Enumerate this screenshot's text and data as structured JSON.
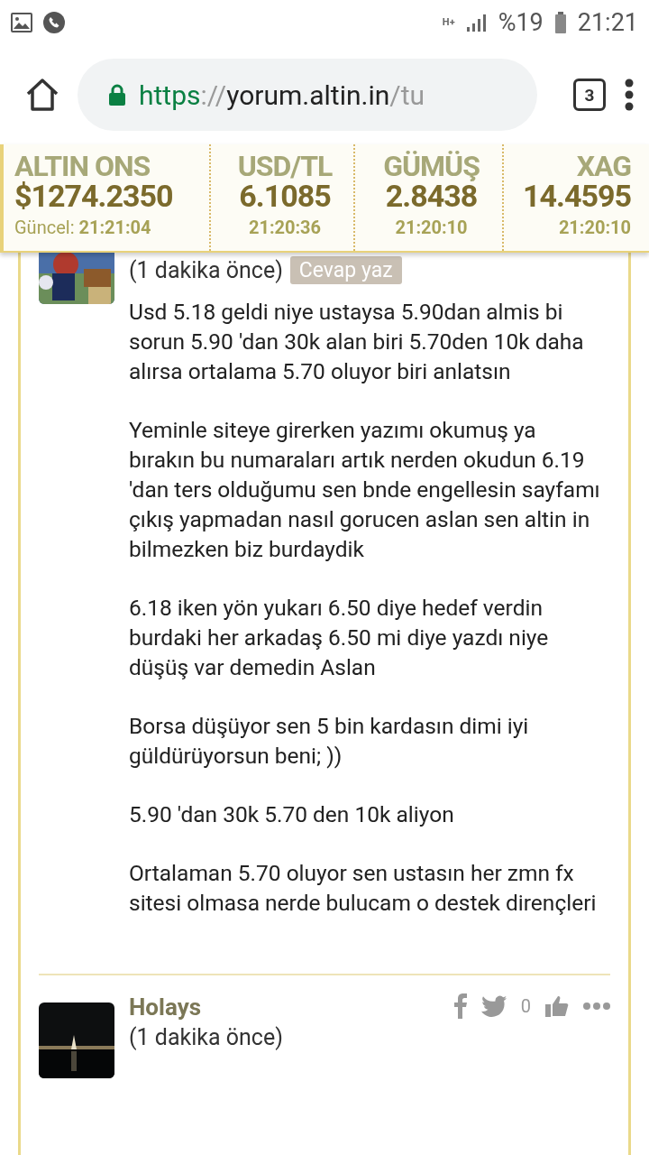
{
  "status_bar": {
    "network": "H+",
    "battery": "%19",
    "time": "21:21"
  },
  "browser": {
    "url_scheme": "https",
    "url_separator": "://",
    "url_host": "yorum.altin.in",
    "url_path": "/tu",
    "tab_count": "3"
  },
  "ticker": [
    {
      "name": "ALTIN ONS",
      "value": "$1274.2350",
      "time_label": "Güncel:",
      "time": "21:21:04"
    },
    {
      "name": "USD/TL",
      "value": "6.1085",
      "time": "21:20:36"
    },
    {
      "name": "GÜMÜŞ",
      "value": "2.8438",
      "time": "21:20:10"
    },
    {
      "name": "XAG",
      "value": "14.4595",
      "time": "21:20:10"
    }
  ],
  "comments": [
    {
      "time": "(1 dakika önce)",
      "reply": "Cevap yaz",
      "paragraphs": [
        "Usd 5.18 geldi niye ustaysa 5.90dan almis bi sorun 5.90 'dan 30k alan biri 5.70den 10k daha alırsa ortalama 5.70 oluyor biri anlatsın",
        "Yeminle siteye girerken yazımı okumuş ya bırakın bu numaraları artık nerden okudun 6.19 'dan ters olduğumu sen bnde engellesin sayfamı çıkış yapmadan nasıl gorucen aslan sen altin in bilmezken biz burdaydik",
        "6.18 iken yön yukarı 6.50 diye hedef verdin burdaki her arkadaş 6.50 mi diye yazdı niye düşüş var demedin Aslan",
        "Borsa düşüyor sen 5 bin kardasın dimi iyi güldürüyorsun beni; ))",
        "5.90 'dan 30k 5.70 den 10k aliyon",
        "Ortalaman 5.70 oluyor sen ustasın her zmn fx sitesi olmasa nerde bulucam o destek dirençleri"
      ]
    },
    {
      "author": "Holays",
      "time": "(1 dakika önce)",
      "likes": "0"
    }
  ]
}
